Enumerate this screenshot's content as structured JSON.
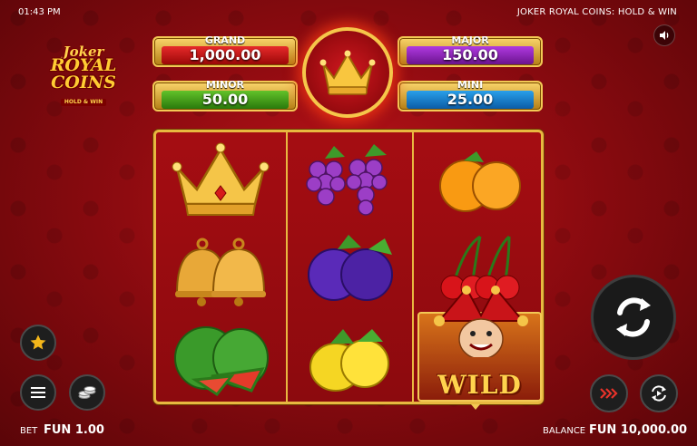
{
  "status_bar": {
    "time": "01:43 PM",
    "game_title": "JOKER ROYAL COINS: HOLD & WIN"
  },
  "logo": {
    "line1": "Joker",
    "line2": "ROYAL COINS",
    "line3": "HOLD & WIN"
  },
  "jackpots": {
    "grand": {
      "label": "GRAND",
      "value": "1,000.00",
      "color": "#c8141a"
    },
    "major": {
      "label": "MAJOR",
      "value": "150.00",
      "color": "#8e25b8"
    },
    "minor": {
      "label": "MINOR",
      "value": "50.00",
      "color": "#3e9a18"
    },
    "mini": {
      "label": "MINI",
      "value": "25.00",
      "color": "#1a7cc9"
    }
  },
  "reels": [
    [
      "crown-icon",
      "bells-icon",
      "watermelon-icon"
    ],
    [
      "grapes-icon",
      "plums-icon",
      "lemons-icon"
    ],
    [
      "oranges-icon",
      "cherries-icon",
      "joker-wild-icon"
    ]
  ],
  "wild_label": "WILD",
  "controls": {
    "favorite": "star-icon",
    "menu": "hamburger-icon",
    "coins": "coin-stack-icon",
    "spin": "spin-arrows-icon",
    "turbo": "triple-chevron-icon",
    "autoplay": "autoplay-icon",
    "sound": "speaker-icon"
  },
  "footer": {
    "bet_label": "BET",
    "bet_value": "FUN 1.00",
    "balance_label": "BALANCE",
    "balance_value": "FUN 10,000.00"
  }
}
